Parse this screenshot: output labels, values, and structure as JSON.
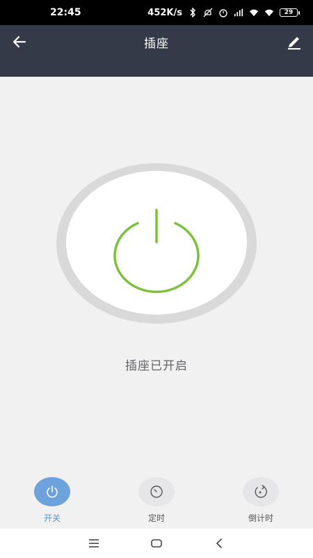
{
  "status_bar": {
    "time": "22:45",
    "network_speed": "452K/s",
    "battery_level": "29"
  },
  "header": {
    "title": "插座"
  },
  "power": {
    "state_text": "插座已开启",
    "icon_color": "#7cc13a"
  },
  "tabs": [
    {
      "label": "开关",
      "icon": "power-icon",
      "active": true
    },
    {
      "label": "定时",
      "icon": "clock-icon",
      "active": false
    },
    {
      "label": "倒计时",
      "icon": "countdown-icon",
      "active": false
    }
  ],
  "colors": {
    "header_bg": "#343a48",
    "accent": "#6ea2dc"
  }
}
